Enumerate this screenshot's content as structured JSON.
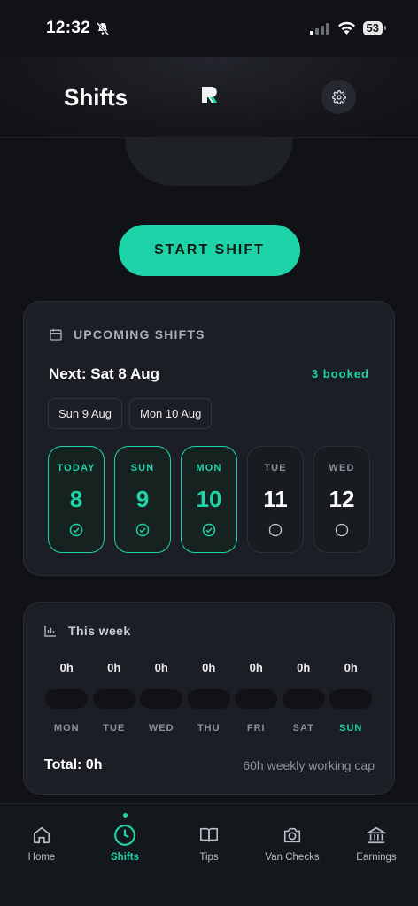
{
  "status_bar": {
    "time": "12:32",
    "battery": "53",
    "icons": [
      "bell-muted-icon",
      "signal-icon",
      "wifi-icon",
      "battery-icon"
    ]
  },
  "header": {
    "title": "Shifts",
    "logo": "app-logo",
    "settings_icon": "gear-icon"
  },
  "start_button": {
    "label": "START SHIFT"
  },
  "upcoming": {
    "heading": "UPCOMING SHIFTS",
    "next": "Next: Sat 8 Aug",
    "booked": "3 booked",
    "chips": [
      "Sun 9 Aug",
      "Mon 10 Aug"
    ],
    "days": [
      {
        "name": "TODAY",
        "num": "8",
        "booked": true
      },
      {
        "name": "SUN",
        "num": "9",
        "booked": true
      },
      {
        "name": "MON",
        "num": "10",
        "booked": true
      },
      {
        "name": "TUE",
        "num": "11",
        "booked": false
      },
      {
        "name": "WED",
        "num": "12",
        "booked": false
      }
    ]
  },
  "week": {
    "heading": "This week",
    "days": [
      {
        "hours": "0h",
        "day": "MON",
        "today": false
      },
      {
        "hours": "0h",
        "day": "TUE",
        "today": false
      },
      {
        "hours": "0h",
        "day": "WED",
        "today": false
      },
      {
        "hours": "0h",
        "day": "THU",
        "today": false
      },
      {
        "hours": "0h",
        "day": "FRI",
        "today": false
      },
      {
        "hours": "0h",
        "day": "SAT",
        "today": false
      },
      {
        "hours": "0h",
        "day": "SUN",
        "today": true
      }
    ],
    "total": "Total: 0h",
    "cap": "60h weekly working cap"
  },
  "tabs": [
    {
      "label": "Home",
      "icon": "home-icon",
      "active": false
    },
    {
      "label": "Shifts",
      "icon": "clock-icon",
      "active": true
    },
    {
      "label": "Tips",
      "icon": "book-icon",
      "active": false
    },
    {
      "label": "Van Checks",
      "icon": "camera-icon",
      "active": false
    },
    {
      "label": "Earnings",
      "icon": "bank-icon",
      "active": false
    }
  ],
  "colors": {
    "accent": "#1dd3a7",
    "background": "#101216",
    "card": "#1b1e24"
  }
}
